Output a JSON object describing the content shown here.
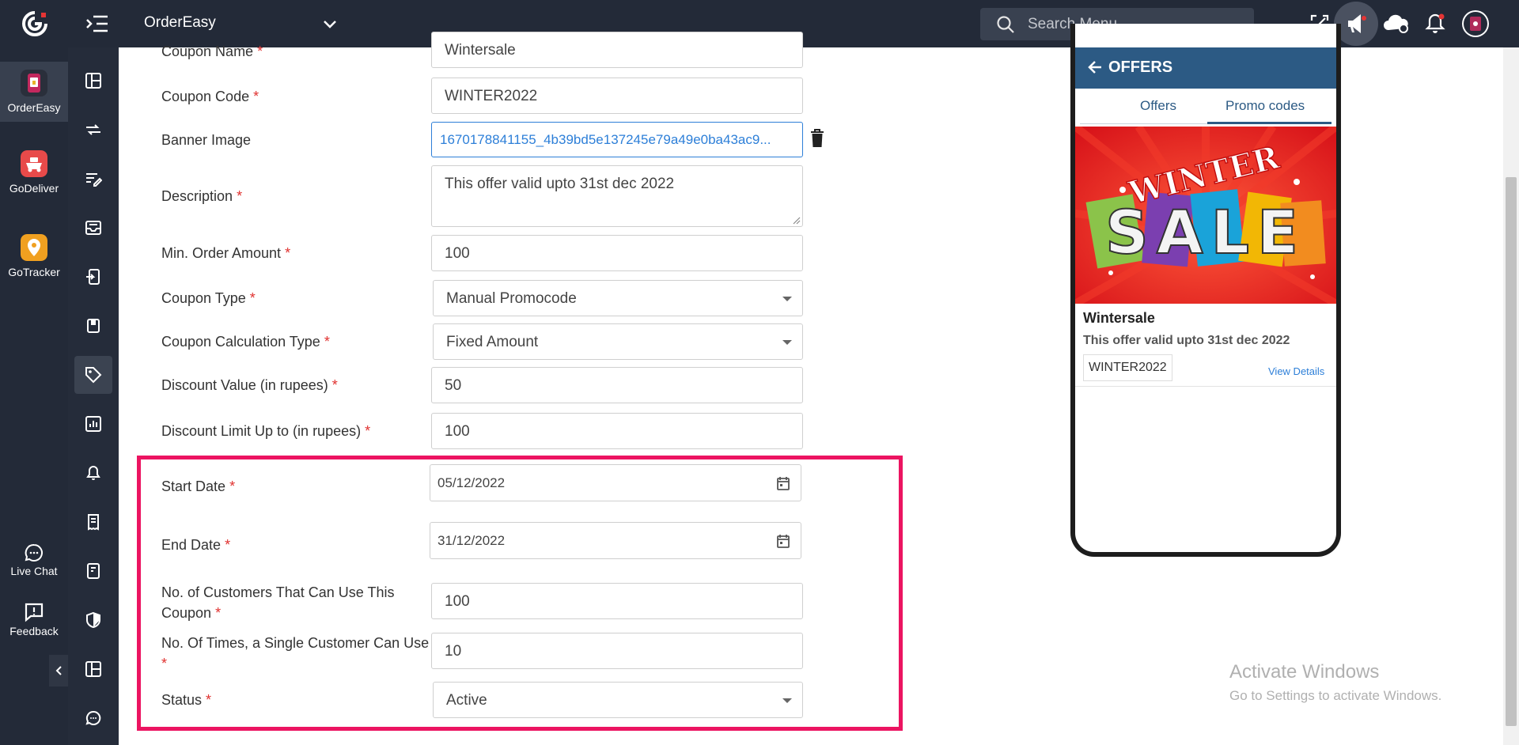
{
  "topbar": {
    "app_name": "OrderEasy",
    "search_placeholder": "Search Menu"
  },
  "rail": {
    "apps": [
      {
        "label": "OrderEasy"
      },
      {
        "label": "GoDeliver"
      },
      {
        "label": "GoTracker"
      }
    ],
    "live_chat": "Live Chat",
    "feedback": "Feedback"
  },
  "form": {
    "coupon_name": {
      "label": "Coupon Name",
      "value": "Wintersale"
    },
    "coupon_code": {
      "label": "Coupon Code",
      "value": "WINTER2022"
    },
    "banner_image": {
      "label": "Banner Image",
      "value": "1670178841155_4b39bd5e137245e79a49e0ba43ac9..."
    },
    "description": {
      "label": "Description",
      "value": "This offer valid upto 31st dec 2022"
    },
    "min_order": {
      "label": "Min. Order Amount",
      "value": "100"
    },
    "coupon_type": {
      "label": "Coupon Type",
      "value": "Manual Promocode"
    },
    "calc_type": {
      "label": "Coupon Calculation Type",
      "value": "Fixed Amount"
    },
    "discount_value": {
      "label": "Discount Value (in rupees)",
      "value": "50"
    },
    "discount_limit": {
      "label": "Discount Limit Up to (in rupees)",
      "value": "100"
    },
    "start_date": {
      "label": "Start Date",
      "value": "05/12/2022"
    },
    "end_date": {
      "label": "End Date",
      "value": "31/12/2022"
    },
    "customers": {
      "label_line1": "No. of Customers That Can Use This",
      "label_line2": "Coupon",
      "value": "100"
    },
    "times_per_customer": {
      "label_line1": "No. Of Times, a Single Customer Can Use",
      "value": "10"
    },
    "status": {
      "label": "Status",
      "value": "Active"
    },
    "required_mark": "*"
  },
  "preview": {
    "header": "OFFERS",
    "tabs": [
      "Offers",
      "Promo codes"
    ],
    "banner_text": [
      "WINTER",
      "SALE"
    ],
    "offer_title": "Wintersale",
    "offer_desc": "This offer valid upto 31st dec 2022",
    "offer_code": "WINTER2022",
    "view_details": "View Details"
  },
  "watermark": {
    "line1": "Activate Windows",
    "line2": "Go to Settings to activate Windows."
  },
  "colors": {
    "topbar": "#232a38",
    "highlight_border": "#ec1461",
    "required": "#e0312f",
    "link": "#2d7fd8",
    "preview_header": "#2c5a84"
  }
}
